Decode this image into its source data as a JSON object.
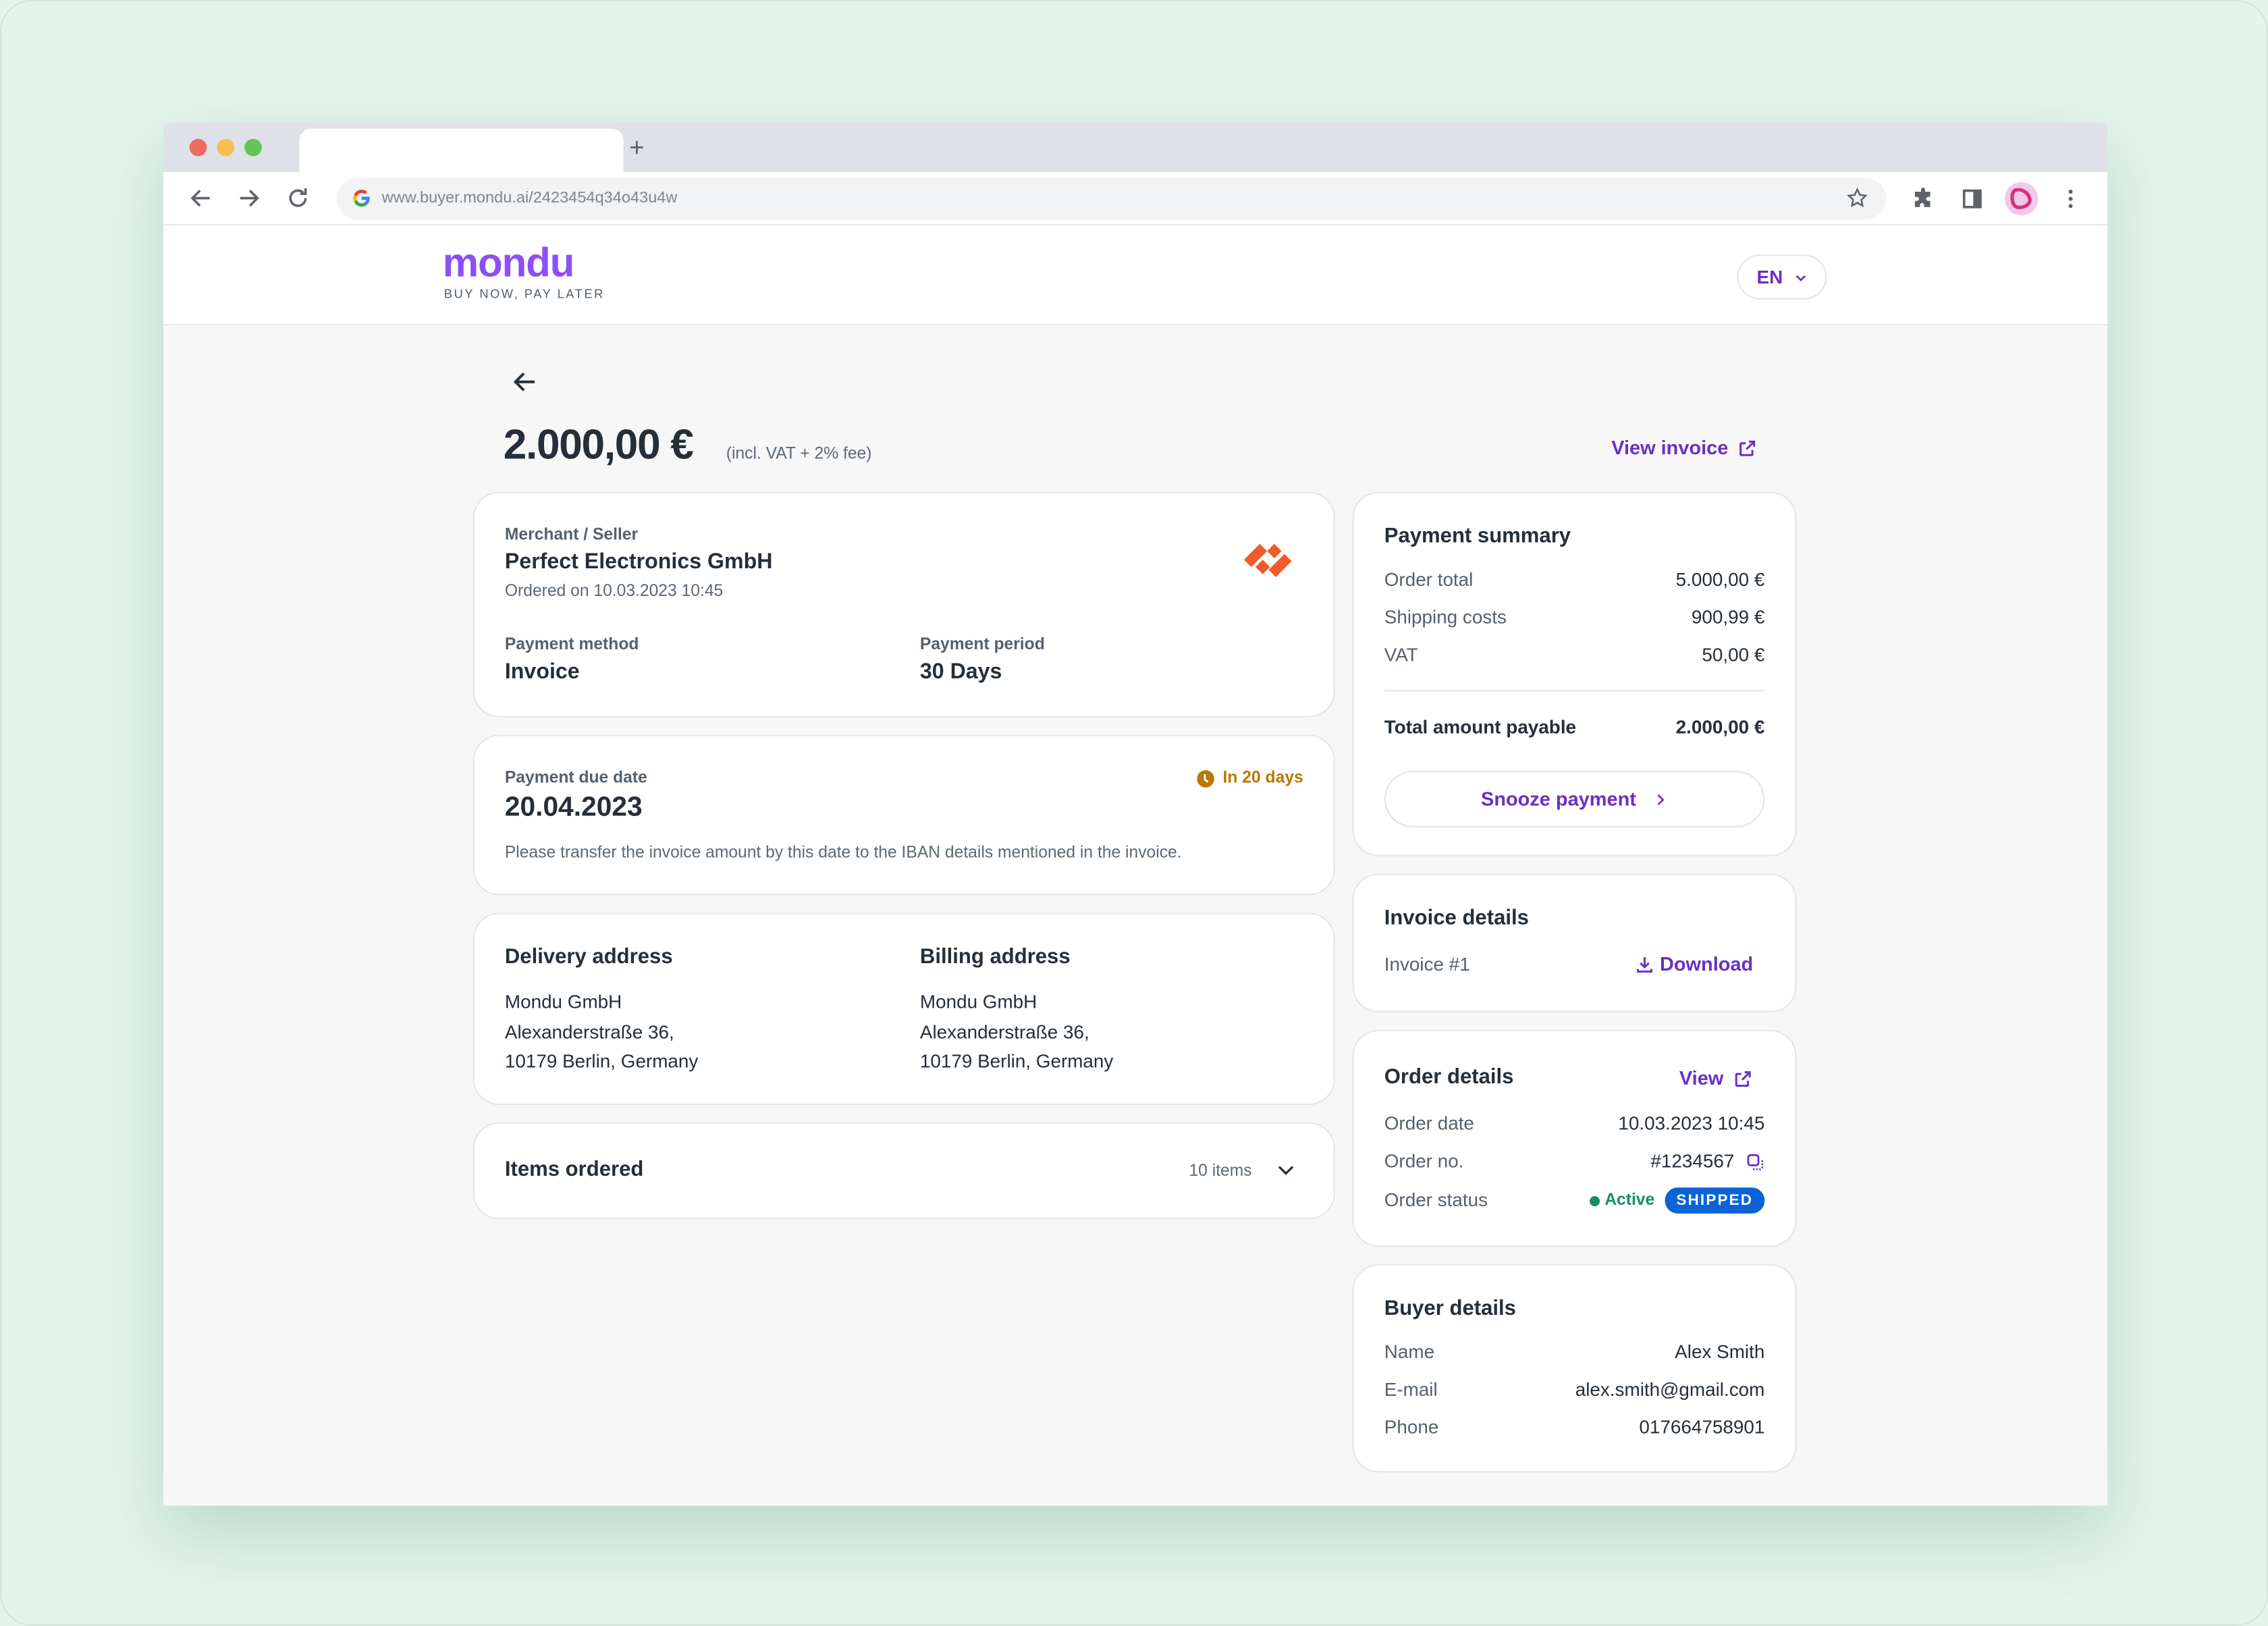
{
  "browser": {
    "url": "www.buyer.mondu.ai/2423454q34o43u4w",
    "new_tab": "+"
  },
  "header": {
    "logo": "mondu",
    "tagline": "BUY NOW, PAY LATER",
    "language": "EN"
  },
  "summary": {
    "amount": "2.000,00 €",
    "amount_note": "(incl. VAT + 2% fee)",
    "view_invoice": "View invoice"
  },
  "merchant": {
    "label": "Merchant / Seller",
    "name": "Perfect Electronics GmbH",
    "ordered_on": "Ordered on 10.03.2023 10:45",
    "payment_method_label": "Payment method",
    "payment_method": "Invoice",
    "payment_period_label": "Payment period",
    "payment_period": "30 Days",
    "brand_color": "#f15a2b"
  },
  "due": {
    "label": "Payment due date",
    "date": "20.04.2023",
    "countdown": "In 20 days",
    "countdown_color": "#b97800",
    "note": "Please transfer the invoice amount by this date to the IBAN details mentioned in the invoice."
  },
  "addresses": {
    "delivery": {
      "title": "Delivery address",
      "lines": [
        "Mondu GmbH",
        "Alexanderstraße 36,",
        "10179 Berlin, Germany"
      ]
    },
    "billing": {
      "title": "Billing address",
      "lines": [
        "Mondu GmbH",
        "Alexanderstraße 36,",
        "10179 Berlin, Germany"
      ]
    }
  },
  "items": {
    "title": "Items ordered",
    "count": "10 items"
  },
  "payment_summary": {
    "title": "Payment summary",
    "rows": [
      {
        "label": "Order total",
        "value": "5.000,00 €"
      },
      {
        "label": "Shipping costs",
        "value": "900,99 €"
      },
      {
        "label": "VAT",
        "value": "50,00 €"
      }
    ],
    "total_label": "Total amount payable",
    "total_value": "2.000,00 €",
    "snooze": "Snooze payment"
  },
  "invoice_details": {
    "title": "Invoice details",
    "invoice": "Invoice #1",
    "download": "Download"
  },
  "order_details": {
    "title": "Order details",
    "view": "View",
    "rows": [
      {
        "label": "Order date",
        "value": "10.03.2023 10:45"
      },
      {
        "label": "Order no.",
        "value": "#1234567"
      },
      {
        "label": "Order status",
        "value": ""
      }
    ],
    "status_active": "Active",
    "status_badge": "SHIPPED"
  },
  "buyer_details": {
    "title": "Buyer details",
    "rows": [
      {
        "label": "Name",
        "value": "Alex Smith"
      },
      {
        "label": "E-mail",
        "value": "alex.smith@gmail.com"
      },
      {
        "label": "Phone",
        "value": "017664758901"
      }
    ]
  },
  "colors": {
    "accent": "#6a2fc6",
    "logo": "#8b4ff6",
    "shipped": "#0b63d6",
    "active": "#11906a"
  }
}
